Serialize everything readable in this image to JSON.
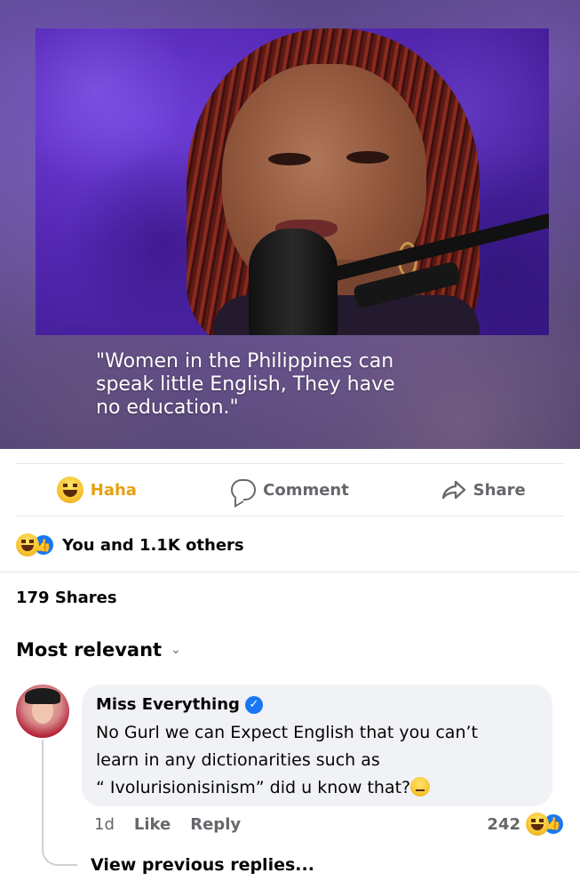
{
  "post": {
    "caption": "\"Women in the Philippines can\nspeak little English, They have\nno education.\""
  },
  "actions": {
    "haha_label": "Haha",
    "comment_label": "Comment",
    "share_label": "Share"
  },
  "reactions": {
    "summary": "You and 1.1K others",
    "icons": [
      "haha-emoji",
      "like-icon"
    ]
  },
  "shares": {
    "text": "179 Shares"
  },
  "sort": {
    "label": "Most relevant",
    "icon": "chevron-down-icon"
  },
  "comment": {
    "author": "Miss Everything",
    "verified": true,
    "text": "No Gurl we can Expect English that you can’t\nlearn in any dictionarities such as\n“ Ivolurisionisinism” did u know that?",
    "time": "1d",
    "like_label": "Like",
    "reply_label": "Reply",
    "reaction_count": "242",
    "view_previous": "View previous replies..."
  },
  "colors": {
    "accent_blue": "#1877f2",
    "haha_yellow": "#e5a013",
    "muted_gray": "#65676b"
  }
}
